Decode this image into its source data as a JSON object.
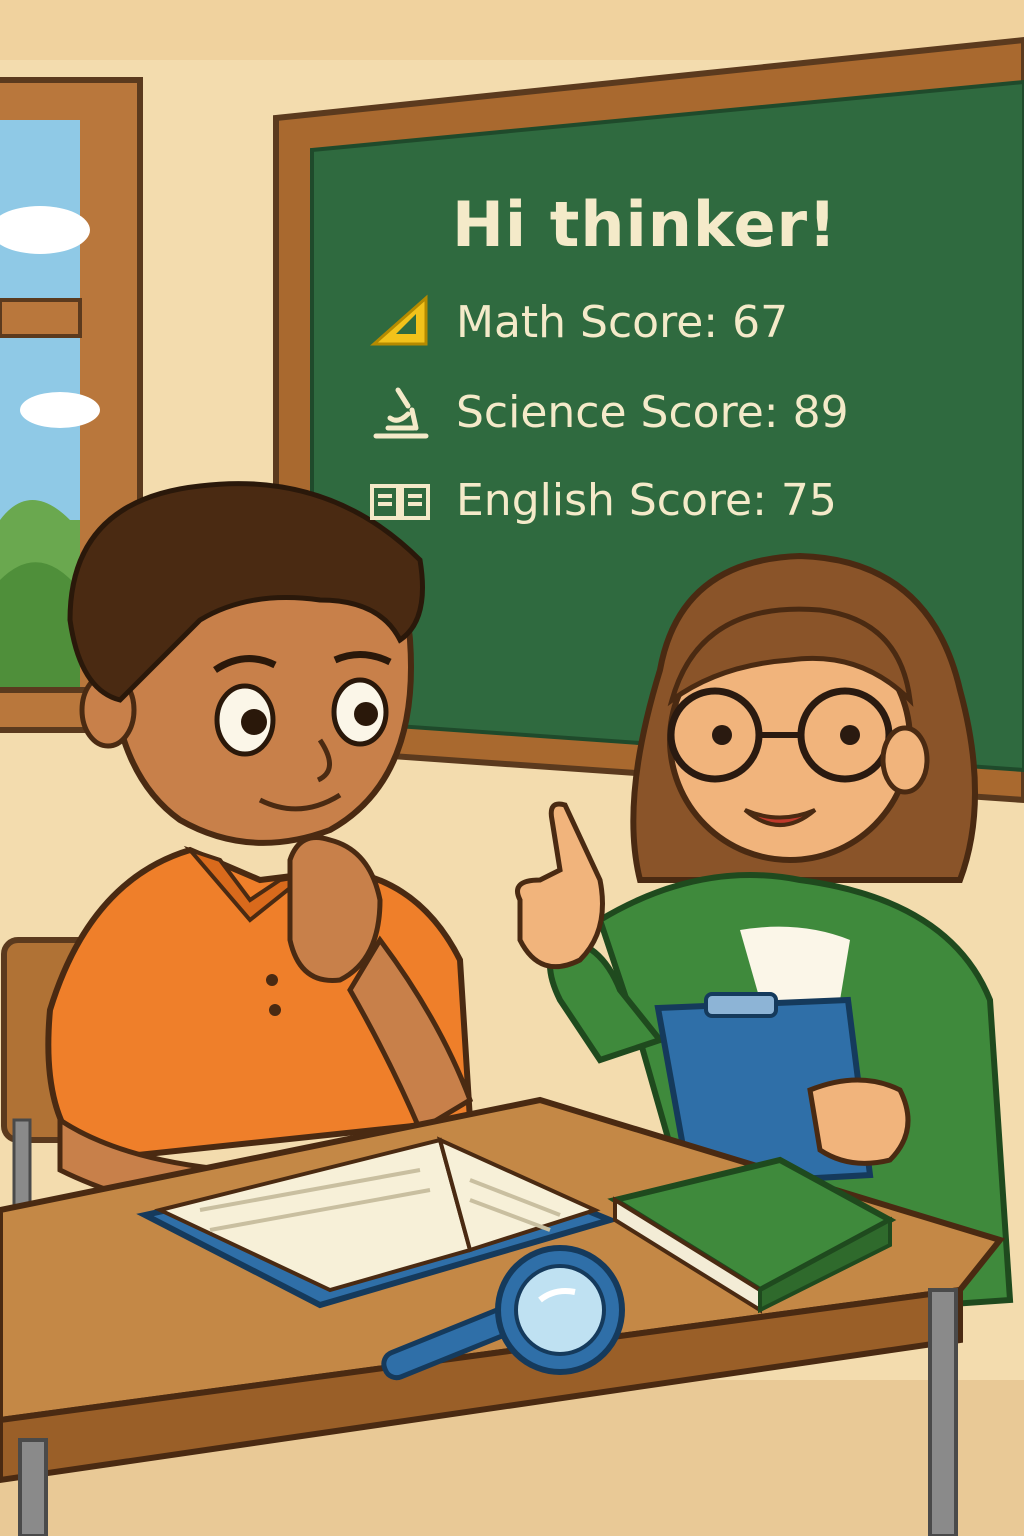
{
  "chalkboard": {
    "greeting": "Hi thinker!",
    "scores": [
      {
        "label": "Math Score: 67",
        "icon": "ruler-triangle-icon",
        "value": 67
      },
      {
        "label": "Science Score: 89",
        "icon": "microscope-icon",
        "value": 89
      },
      {
        "label": "English Score: 75",
        "icon": "open-book-icon",
        "value": 75
      }
    ]
  },
  "palette": {
    "wall": "#f3dcae",
    "chalkboard": "#2f6a3f",
    "board_frame": "#a9692f",
    "chalk": "#f4eac9",
    "icon_yellow": "#f2c21a",
    "boy_shirt": "#ef7f2a",
    "teacher_cardigan": "#3f8a3c",
    "clipboard": "#2f6fa8",
    "desk": "#b07235"
  }
}
